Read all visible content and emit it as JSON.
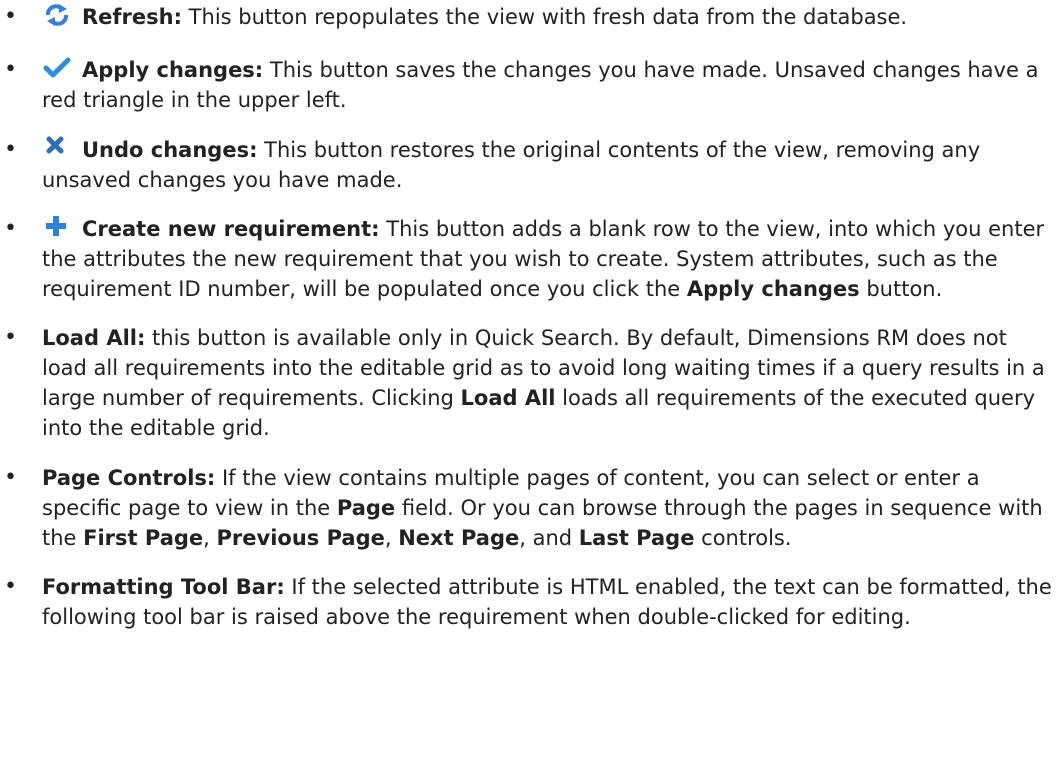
{
  "items": [
    {
      "icon": "refresh-icon",
      "term": "Refresh:",
      "text": " This button repopulates the view with fresh data from the database."
    },
    {
      "icon": "checkmark-icon",
      "term": "Apply changes:",
      "text": " This button saves the changes you have made. Unsaved changes have a red triangle in the upper left."
    },
    {
      "icon": "x-icon",
      "term": "Undo changes:",
      "text": " This button restores the original contents of the view, removing any unsaved changes you have made."
    },
    {
      "icon": "plus-icon",
      "term": "Create new requirement:",
      "text1": " This button adds a blank row to the view, into which you enter the attributes the new requirement that you wish to create. System attributes, such as the requirement ID number, will be populated once you click the ",
      "bold1": "Apply changes",
      "text2": " button."
    },
    {
      "term": "Load All:",
      "text1": " this button is available only in Quick Search. By default, Dimensions RM does not load all requirements into the editable grid as to avoid long waiting times if a query results in a large number of requirements. Clicking ",
      "bold1": "Load All",
      "text2": " loads all requirements of the executed query into the editable grid."
    },
    {
      "term": "Page Controls:",
      "text1": " If the view contains multiple pages of content, you can select or enter a specific page to view in the ",
      "bold1": "Page",
      "text2": " field. Or you can browse through the pages in sequence with the ",
      "bold2": "First Page",
      "sep1": ", ",
      "bold3": "Previous Page",
      "sep2": ", ",
      "bold4": "Next Page",
      "sep3": ", and ",
      "bold5": "Last Page",
      "text3": " controls."
    },
    {
      "term": "Formatting Tool Bar:",
      "text": " If the selected attribute is HTML enabled, the text can be formatted, the following tool bar is raised above the requirement when double-clicked for editing."
    }
  ],
  "bullet_char": "•",
  "colors": {
    "text": "#222222",
    "refresh_icon": "#3a7fd5",
    "check_icon": "#2f8fd8",
    "x_icon": "#2f6fb8",
    "plus_icon": "#2f82d6"
  }
}
